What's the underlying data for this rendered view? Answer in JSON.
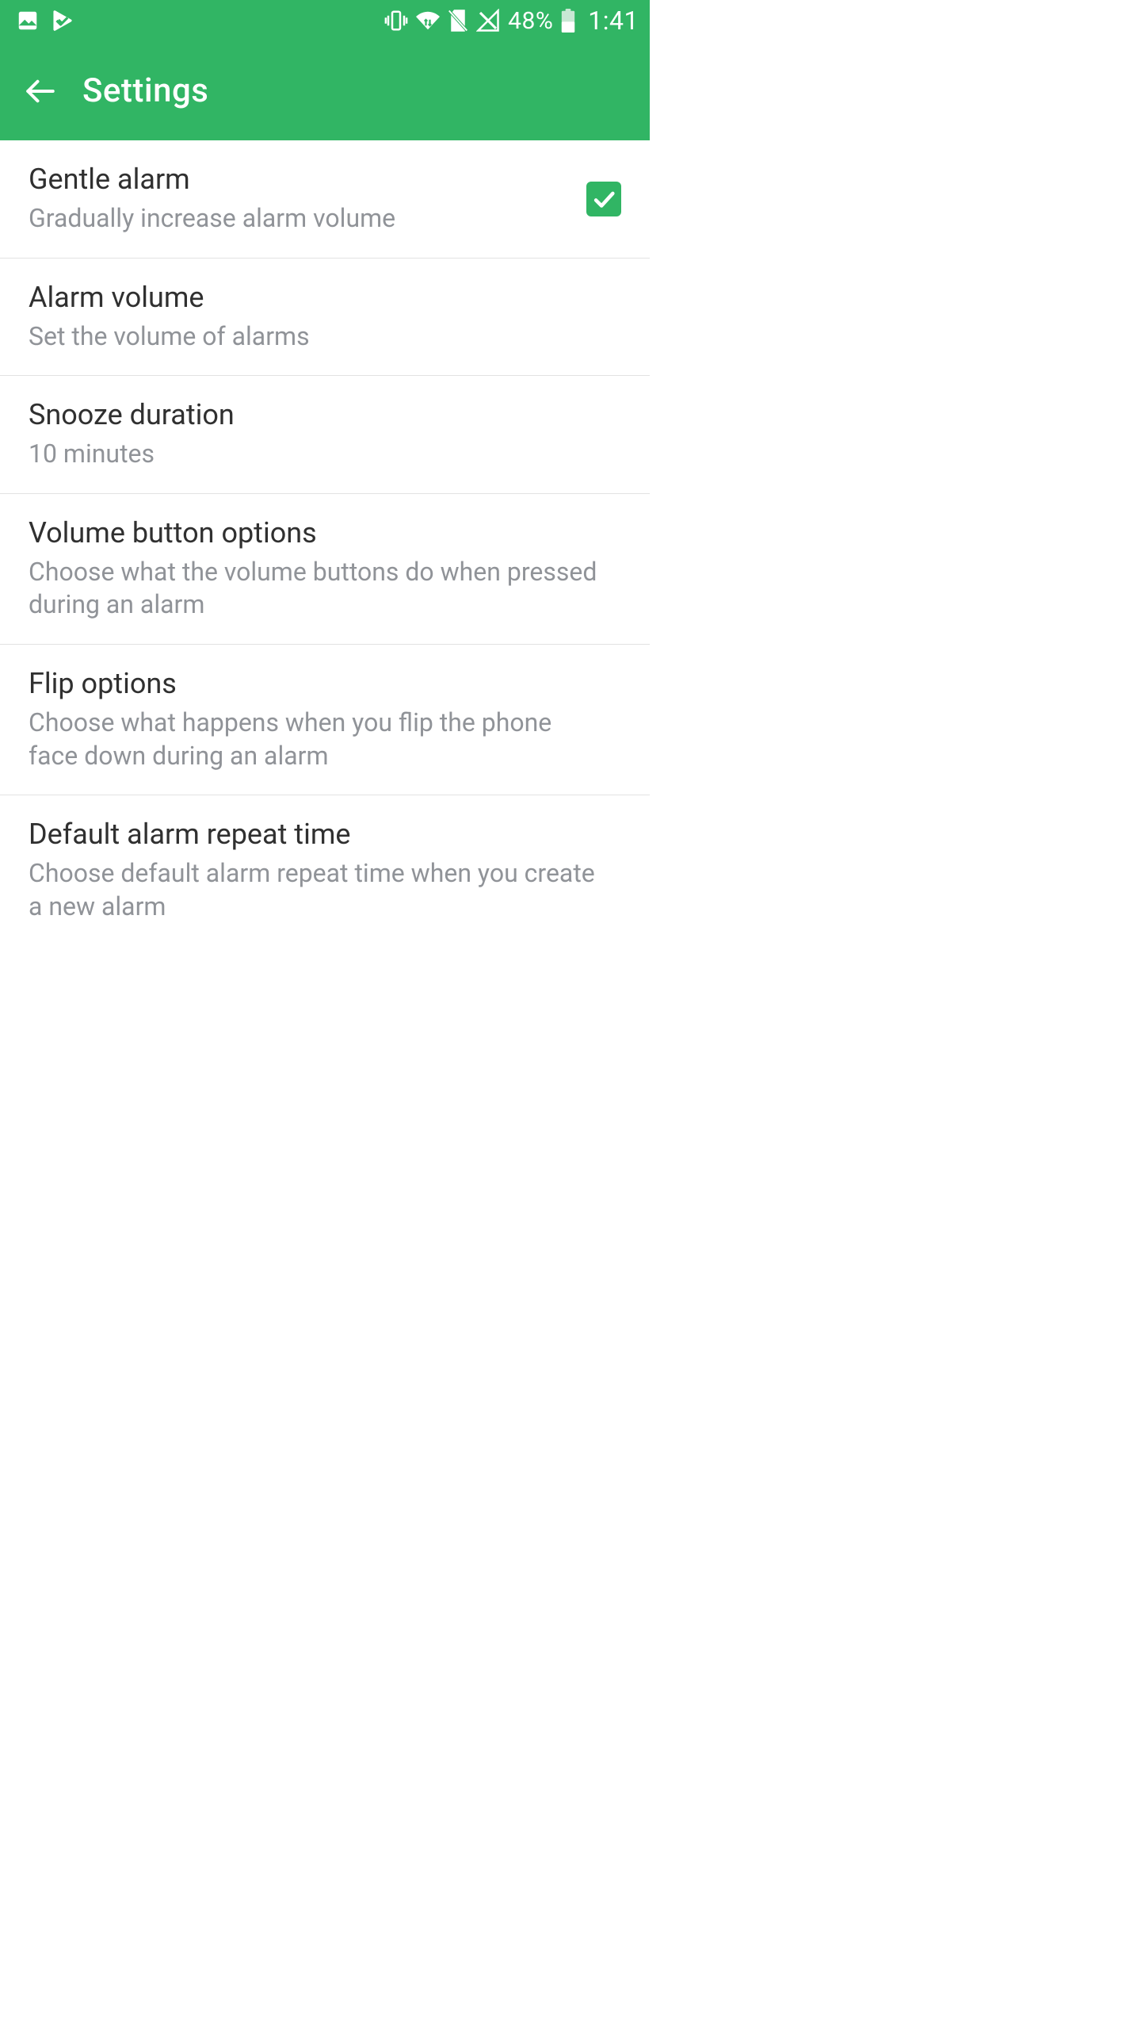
{
  "colors": {
    "accent": "#31b564",
    "divider": "#e2e2e2",
    "title": "#303030",
    "subtitle": "#909398"
  },
  "status": {
    "battery_pct": "48%",
    "time": "1:41",
    "icons": {
      "picture": "picture-icon",
      "play": "play-icon",
      "vibrate": "vibrate-icon",
      "wifi": "wifi-icon",
      "sd_none": "no-sd-icon",
      "signal_none": "no-signal-icon",
      "battery": "battery-icon"
    }
  },
  "header": {
    "title": "Settings"
  },
  "settings": [
    {
      "title": "Gentle alarm",
      "subtitle": "Gradually increase alarm volume",
      "has_checkbox": true,
      "checked": true
    },
    {
      "title": "Alarm volume",
      "subtitle": "Set the volume of alarms",
      "has_checkbox": false
    },
    {
      "title": "Snooze duration",
      "subtitle": "10 minutes",
      "has_checkbox": false
    },
    {
      "title": "Volume button options",
      "subtitle": "Choose what the volume buttons do when pressed during an alarm",
      "has_checkbox": false
    },
    {
      "title": "Flip options",
      "subtitle": "Choose what happens when you flip the phone face down during an alarm",
      "has_checkbox": false
    },
    {
      "title": "Default alarm repeat time",
      "subtitle": "Choose default alarm repeat time when you create a new alarm",
      "has_checkbox": false
    }
  ]
}
